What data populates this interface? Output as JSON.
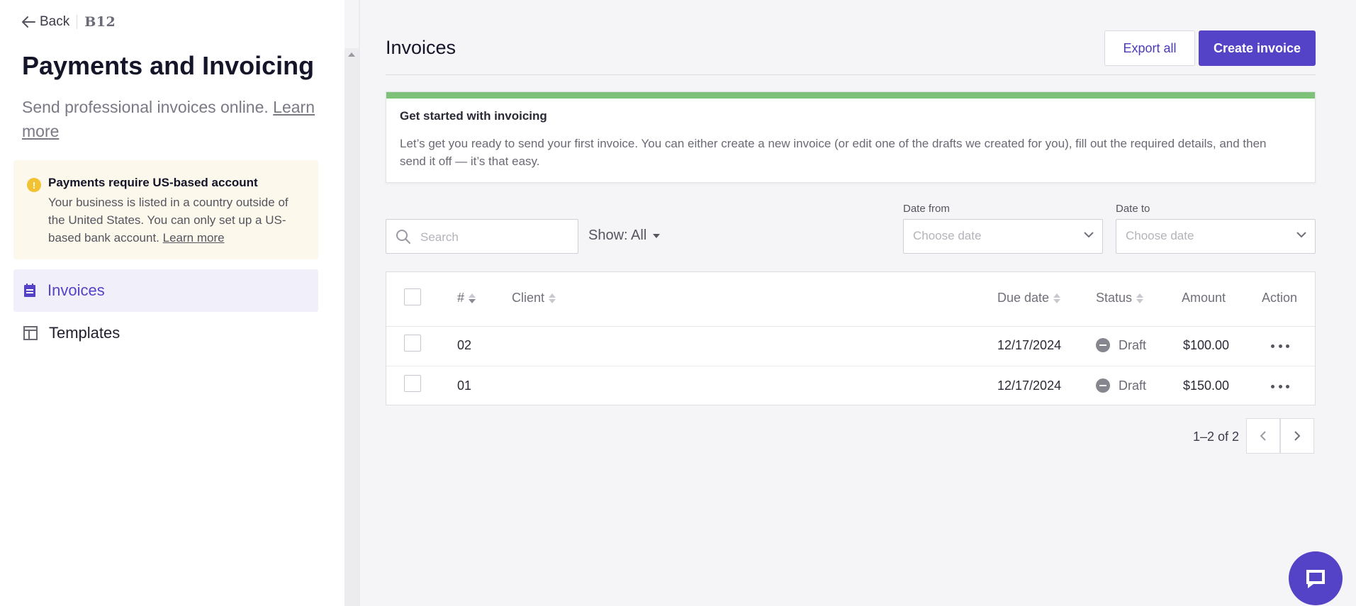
{
  "sidebar": {
    "back_label": "Back",
    "brand": "B12",
    "title": "Payments and Invoicing",
    "description": "Send professional invoices online.",
    "description_link": "Learn more",
    "warning": {
      "title": "Payments require US-based account",
      "body": "Your business is listed in a country outside of the United States. You can only set up a US-based bank account.",
      "link": "Learn more"
    },
    "nav": [
      {
        "label": "Invoices",
        "icon": "invoice-icon",
        "active": true
      },
      {
        "label": "Templates",
        "icon": "template-icon",
        "active": false
      }
    ]
  },
  "main": {
    "title": "Invoices",
    "export_label": "Export all",
    "create_label": "Create invoice",
    "banner": {
      "title": "Get started with invoicing",
      "text": "Let’s get you ready to send your first invoice. You can either create a new invoice (or edit one of the drafts we created for you), fill out the required details, and then send it off — it’s that easy."
    },
    "filters": {
      "search_placeholder": "Search",
      "show_label": "Show: All",
      "date_from_label": "Date from",
      "date_to_label": "Date to",
      "date_placeholder": "Choose date"
    },
    "table": {
      "columns": {
        "number": "#",
        "client": "Client",
        "due_date": "Due date",
        "status": "Status",
        "amount": "Amount",
        "action": "Action"
      },
      "rows": [
        {
          "number": "02",
          "client": "",
          "due_date": "12/17/2024",
          "status": "Draft",
          "amount": "$100.00"
        },
        {
          "number": "01",
          "client": "",
          "due_date": "12/17/2024",
          "status": "Draft",
          "amount": "$150.00"
        }
      ]
    },
    "pagination": "1–2 of 2"
  },
  "colors": {
    "accent": "#5443c7",
    "banner_bar": "#7ec27a",
    "warning_bg": "#fdf8ec",
    "warning_icon": "#f1c232"
  }
}
